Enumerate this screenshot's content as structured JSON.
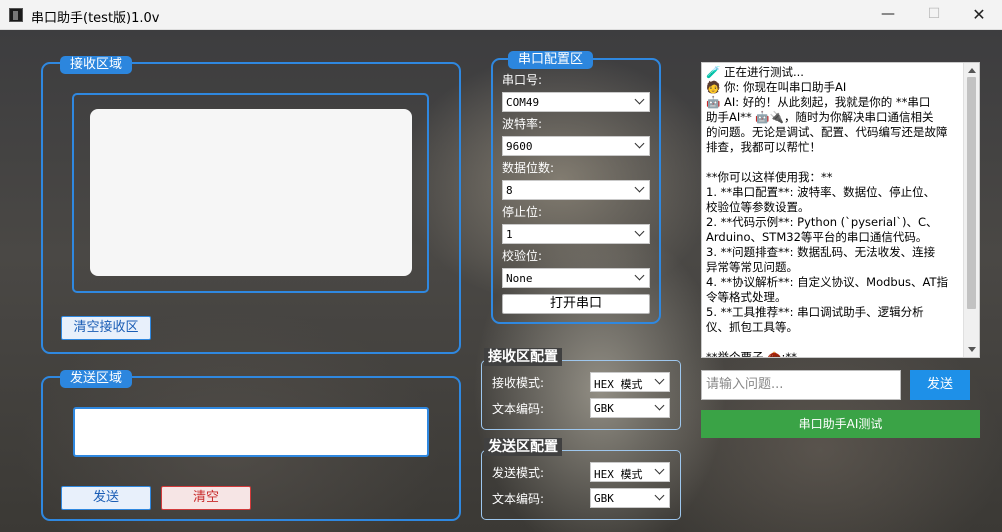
{
  "window": {
    "title": "串口助手(test版)1.0v",
    "min": "—",
    "max": "☐",
    "close": "✕"
  },
  "receive": {
    "group_title": "接收区域",
    "clear_label": "清空接收区"
  },
  "send": {
    "group_title": "发送区域",
    "send_label": "发送",
    "clear_label": "清空"
  },
  "serial": {
    "group_title": "串口配置区",
    "port_label": "串口号:",
    "port_value": "COM49",
    "baud_label": "波特率:",
    "baud_value": "9600",
    "databits_label": "数据位数:",
    "databits_value": "8",
    "stopbits_label": "停止位:",
    "stopbits_value": "1",
    "parity_label": "校验位:",
    "parity_value": "None",
    "open_label": "打开串口"
  },
  "rx_config": {
    "title": "接收区配置",
    "mode_label": "接收模式:",
    "mode_value": "HEX 模式",
    "enc_label": "文本编码:",
    "enc_value": "GBK"
  },
  "tx_config": {
    "title": "发送区配置",
    "mode_label": "发送模式:",
    "mode_value": "HEX 模式",
    "enc_label": "文本编码:",
    "enc_value": "GBK"
  },
  "chat": {
    "lines": [
      "🧪 正在进行测试...",
      "🧑 你: 你现在叫串口助手AI",
      "🤖 AI: 好的！从此刻起，我就是你的 **串口",
      "助手AI** 🤖🔌，随时为你解决串口通信相关",
      "的问题。无论是调试、配置、代码编写还是故障",
      "排查，我都可以帮忙！",
      "",
      "**你可以这样使用我：**",
      "1. **串口配置**: 波特率、数据位、停止位、",
      "校验位等参数设置。",
      "2. **代码示例**: Python (`pyserial`)、C、",
      "Arduino、STM32等平台的串口通信代码。",
      "3. **问题排查**: 数据乱码、无法收发、连接",
      "异常等常见问题。",
      "4. **协议解析**: 自定义协议、Modbus、AT指",
      "令等格式处理。",
      "5. **工具推荐**: 串口调试助手、逻辑分析",
      "仪、抓包工具等。",
      "",
      "**举个栗子 🌰:**"
    ],
    "input_placeholder": "请输入问题...",
    "send_label": "发送",
    "test_label": "串口助手AI测试"
  }
}
